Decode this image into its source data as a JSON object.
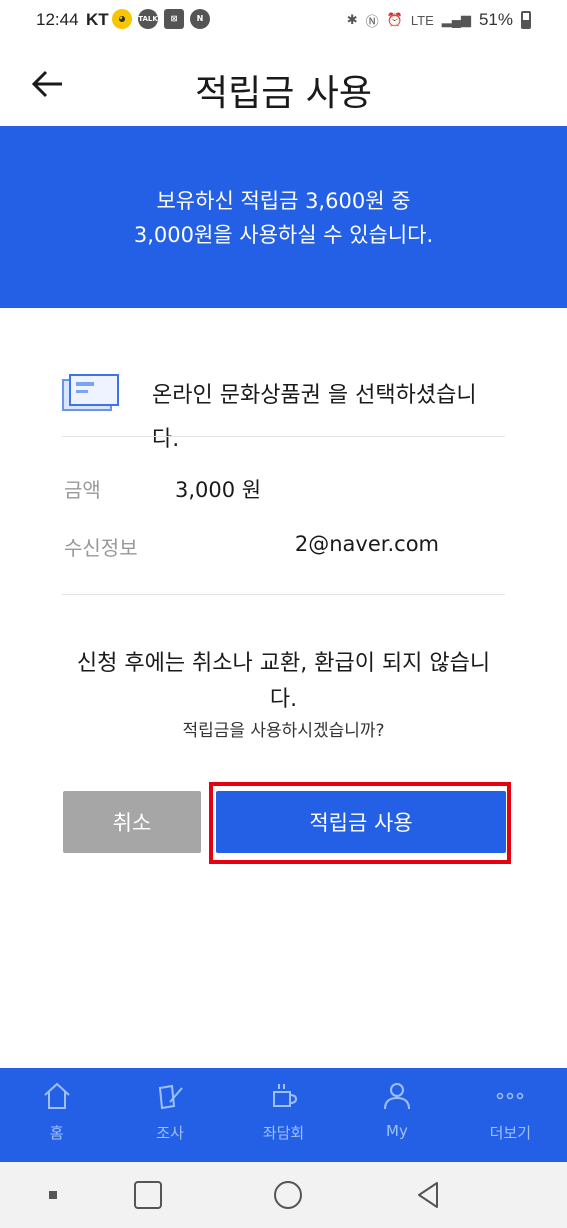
{
  "status_bar": {
    "time": "12:44",
    "carrier": "KT",
    "network": "LTE",
    "battery": "51%"
  },
  "header": {
    "title": "적립금 사용",
    "back_icon": "arrow-left-icon"
  },
  "banner": {
    "line1": "보유하신 적립금 3,600원 중",
    "line2": "3,000원을 사용하실 수 있습니다.",
    "color": "#2460e6"
  },
  "selection": {
    "icon": "gift-card-icon",
    "text": "온라인 문화상품권 을 선택하셨습니다."
  },
  "details": {
    "amount_label": "금액",
    "amount_value": "3,000 원",
    "recipient_label": "수신정보",
    "recipient_value": "2@naver.com"
  },
  "notice": {
    "warning": "신청 후에는 취소나 교환, 환급이 되지 않습니다.",
    "question": "적립금을 사용하시겠습니까?"
  },
  "buttons": {
    "cancel": "취소",
    "use": "적립금 사용",
    "highlight_color": "#e60012"
  },
  "bottom_nav": {
    "items": [
      {
        "label": "홈",
        "icon": "home-icon"
      },
      {
        "label": "조사",
        "icon": "survey-icon"
      },
      {
        "label": "좌담회",
        "icon": "coffee-cup-icon"
      },
      {
        "label": "My",
        "icon": "person-icon"
      },
      {
        "label": "더보기",
        "icon": "more-dots-icon"
      }
    ]
  }
}
